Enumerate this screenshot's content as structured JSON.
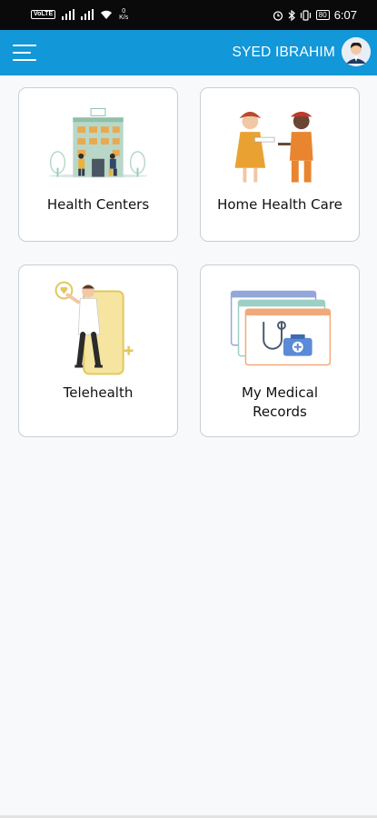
{
  "status_bar": {
    "network_label": "VoLTE",
    "speed_value": "0",
    "speed_unit": "K/s",
    "battery": "80",
    "time": "6:07"
  },
  "app_bar": {
    "user_name": "SYED IBRAHIM"
  },
  "cards": [
    {
      "label": "Health Centers"
    },
    {
      "label": "Home Health Care"
    },
    {
      "label": "Telehealth"
    },
    {
      "label": "My Medical Records"
    }
  ],
  "colors": {
    "app_bar": "#1297d8",
    "background": "#f8f9fa",
    "card_border": "#c9ced6"
  }
}
